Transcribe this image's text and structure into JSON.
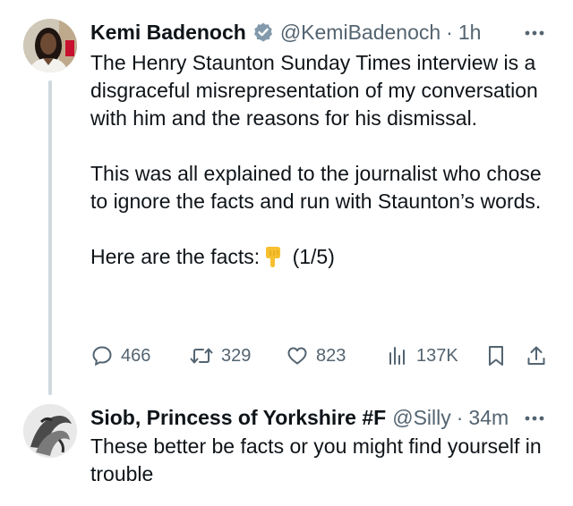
{
  "main_tweet": {
    "author_name": "Kemi Badenoch",
    "handle": "@KemiBadenoch",
    "separator": "·",
    "time": "1h",
    "paragraphs": [
      "The Henry Staunton Sunday Times interview is a disgraceful misrepresentation of my conversation with him and the reasons for his dismissal.",
      "This was all explained to the journalist who chose to ignore the facts and run with Staunton’s words."
    ],
    "facts_line": "Here are the facts:",
    "facts_emoji": "pointing-down-emoji",
    "facts_suffix": "(1/5)",
    "stats": {
      "replies": "466",
      "retweets": "329",
      "likes": "823",
      "views": "137K"
    }
  },
  "reply_tweet": {
    "author_name": "Siob, Princess of Yorkshire #F",
    "handle": "@Silly",
    "separator": "·",
    "time": "34m",
    "text": "These better be facts or you might find yourself in trouble"
  },
  "icons": {
    "verified": "verified-badge-icon",
    "more": "more-options-icon",
    "reply": "reply-icon",
    "retweet": "retweet-icon",
    "like": "heart-icon",
    "views": "views-icon",
    "bookmark": "bookmark-icon",
    "share": "share-icon"
  },
  "colors": {
    "text_primary": "#0f1419",
    "text_secondary": "#536471",
    "verified_badge": "#829aab",
    "thread_line": "#cfd9de"
  }
}
